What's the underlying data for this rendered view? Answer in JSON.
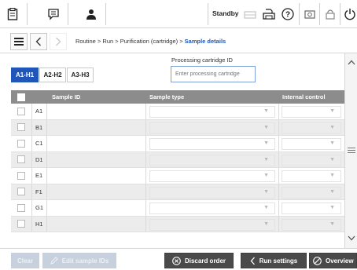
{
  "toolbar": {
    "status": "Standby",
    "icons": [
      "clipboard-icon",
      "message-icon",
      "user-icon",
      "printer-icon",
      "tray-icon",
      "help-icon",
      "screenshot-icon",
      "lock-icon",
      "power-icon"
    ]
  },
  "nav": {
    "breadcrumb": [
      "Routine",
      "Run",
      "Purification (cartridge)",
      "Sample details"
    ]
  },
  "tabs": [
    "A1-H1",
    "A2-H2",
    "A3-H3"
  ],
  "processing_cartridge": {
    "label": "Processing cartridge ID",
    "placeholder": "Enter processing cartridge"
  },
  "table": {
    "headers": [
      "Sample ID",
      "Sample type",
      "Internal control"
    ],
    "rows": [
      "A1",
      "B1",
      "C1",
      "D1",
      "E1",
      "F1",
      "G1",
      "H1"
    ]
  },
  "bottom": {
    "clear": "Clear",
    "edit": "Edit sample IDs",
    "discard": "Discard order",
    "run_settings": "Run settings",
    "overview": "Overview"
  },
  "colors": {
    "accent": "#1f56b8",
    "header": "#8c8c8c",
    "dark_button": "#4a4a4a"
  }
}
